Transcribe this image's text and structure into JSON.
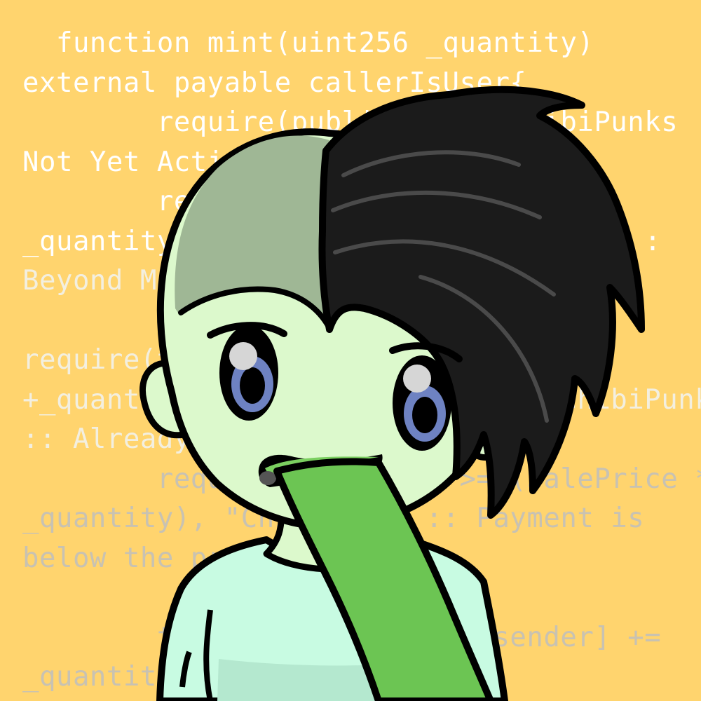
{
  "background_color": "#ffd46e",
  "code_lines": [
    "  function mint(uint256 _quantity)",
    "external payable callerIsUser{",
    "        require(publicSale, \"ChibiPunks",
    "Not Yet Active.\");",
    "        require(totalSupply() +",
    "_quantity <= MAX_SUPPLY, \"ChibiPunks :",
    "Beyond Max Supply\");",
    "",
    "require(totalPublicMint[msg.sender]",
    "+_quantity <= MAX_PUBLIC_MINT, \"ChibiPunks",
    ":: Already minted 3 times!\");",
    "        require(msg.value >= (SalePrice *",
    "_quantity), \"ChibiPunks :: Payment is",
    "below the price\");",
    "",
    "        totalPublicMint[msg.sender] +=",
    "_quantity;"
  ],
  "colors": {
    "code_top": "#ffffff",
    "code_mid": "#f3efe0",
    "code_low": "#c8c2b2",
    "skin": "#dcf9cc",
    "shaved_scalp": "#9fb795",
    "hair": "#1b1b1b",
    "iris": "#6e82c2",
    "tongue": "#6cc553",
    "shirt": "#c8fbe2",
    "outline": "#000000"
  },
  "figure": {
    "hairstyle": "half-shaved side part",
    "expression": "tongue out",
    "shirt": "mint t-shirt"
  }
}
